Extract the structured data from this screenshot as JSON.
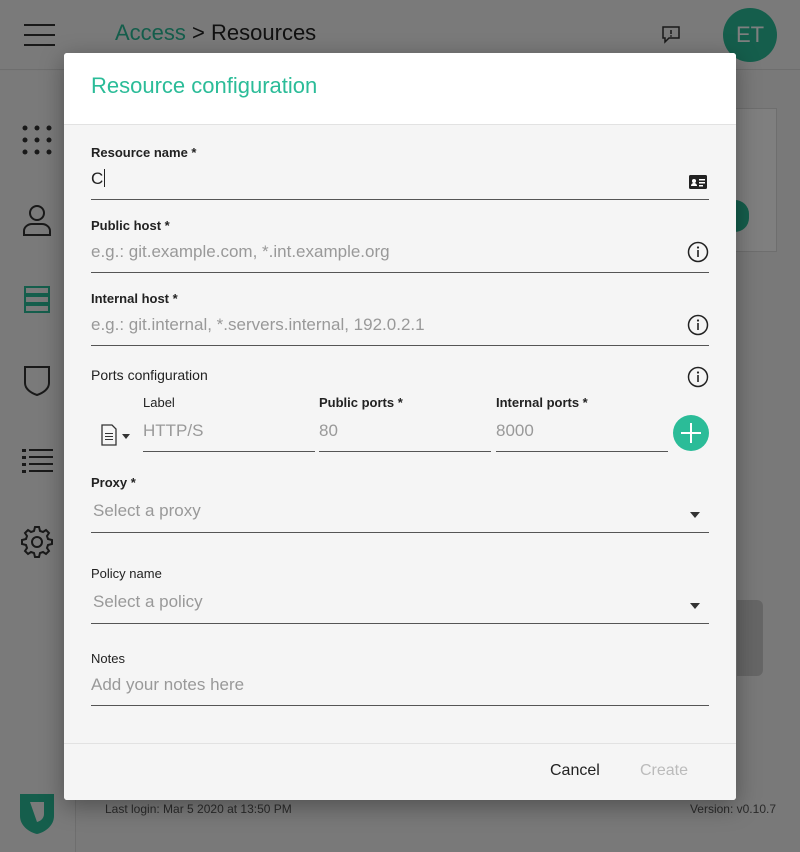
{
  "app": {
    "breadcrumb": {
      "parent": "Access",
      "separator": ">",
      "current": "Resources"
    },
    "avatar_initials": "ET",
    "footer": {
      "last_login": "Last login: Mar 5 2020 at 13:50 PM",
      "version": "Version: v0.10.7"
    },
    "sidebar_icons": [
      "apps-grid-icon",
      "user-icon",
      "server-icon",
      "shield-icon",
      "list-icon",
      "gear-icon"
    ],
    "accent_color": "#2bbc98"
  },
  "modal": {
    "title": "Resource configuration",
    "resource_name": {
      "label": "Resource name *",
      "value": "C",
      "icon": "id-card-icon"
    },
    "public_host": {
      "label": "Public host *",
      "placeholder": "e.g.: git.example.com, *.int.example.org",
      "icon": "info-icon"
    },
    "internal_host": {
      "label": "Internal host *",
      "placeholder": "e.g.: git.internal, *.servers.internal, 192.0.2.1",
      "icon": "info-icon"
    },
    "ports": {
      "label": "Ports configuration",
      "icon": "info-icon",
      "protocol_icon": "document-icon",
      "columns": {
        "label": {
          "header": "Label",
          "placeholder": "HTTP/S"
        },
        "public_ports": {
          "header": "Public ports *",
          "placeholder": "80"
        },
        "internal_ports": {
          "header": "Internal ports *",
          "placeholder": "8000"
        }
      }
    },
    "proxy": {
      "label": "Proxy *",
      "placeholder": "Select a proxy"
    },
    "policy": {
      "label": "Policy name",
      "placeholder": "Select a policy"
    },
    "notes": {
      "label": "Notes",
      "placeholder": "Add your notes here"
    },
    "buttons": {
      "cancel": "Cancel",
      "create": "Create"
    }
  }
}
